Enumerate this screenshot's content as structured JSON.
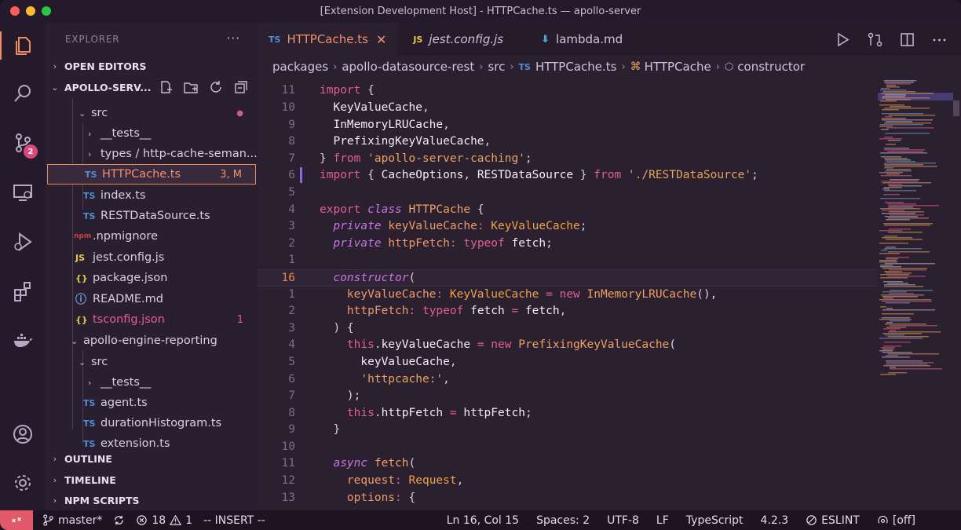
{
  "window": {
    "title": "[Extension Development Host] - HTTPCache.ts — apollo-server"
  },
  "activity": {
    "scm_badge": "2"
  },
  "sidebar": {
    "header": "EXPLORER",
    "more": "···",
    "sections": {
      "open_editors": "OPEN EDITORS",
      "project": "APOLLO-SERV...",
      "outline": "OUTLINE",
      "timeline": "TIMELINE",
      "npm_scripts": "NPM SCRIPTS"
    },
    "tree": [
      {
        "label": "src",
        "chev": "⌄",
        "icon": "",
        "deco": "●"
      },
      {
        "label": "__tests__",
        "chev": "›",
        "icon": "",
        "deco": ""
      },
      {
        "label": "types / http-cache-seman...",
        "chev": "›",
        "icon": "",
        "deco": ""
      },
      {
        "label": "HTTPCache.ts",
        "chev": "",
        "icon": "TS",
        "deco": "3, M"
      },
      {
        "label": "index.ts",
        "chev": "",
        "icon": "TS",
        "deco": ""
      },
      {
        "label": "RESTDataSource.ts",
        "chev": "",
        "icon": "TS",
        "deco": ""
      },
      {
        "label": ".npmignore",
        "chev": "",
        "icon": "npm",
        "deco": ""
      },
      {
        "label": "jest.config.js",
        "chev": "",
        "icon": "JS",
        "deco": ""
      },
      {
        "label": "package.json",
        "chev": "",
        "icon": "{}",
        "deco": ""
      },
      {
        "label": "README.md",
        "chev": "",
        "icon": "ⓘ",
        "deco": ""
      },
      {
        "label": "tsconfig.json",
        "chev": "",
        "icon": "{}",
        "deco": "1"
      },
      {
        "label": "apollo-engine-reporting",
        "chev": "⌄",
        "icon": "",
        "deco": ""
      },
      {
        "label": "src",
        "chev": "⌄",
        "icon": "",
        "deco": ""
      },
      {
        "label": "__tests__",
        "chev": "›",
        "icon": "",
        "deco": ""
      },
      {
        "label": "agent.ts",
        "chev": "",
        "icon": "TS",
        "deco": ""
      },
      {
        "label": "durationHistogram.ts",
        "chev": "",
        "icon": "TS",
        "deco": ""
      },
      {
        "label": "extension.ts",
        "chev": "",
        "icon": "TS",
        "deco": ""
      }
    ]
  },
  "tabs": [
    {
      "icon": "TS",
      "label": "HTTPCache.ts",
      "close": "✕"
    },
    {
      "icon": "JS",
      "label": "jest.config.js"
    },
    {
      "icon": "⬇",
      "label": "lambda.md"
    }
  ],
  "breadcrumb": [
    "packages",
    "apollo-datasource-rest",
    "src",
    "HTTPCache.ts",
    "HTTPCache",
    "constructor"
  ],
  "breadcrumb_icons": {
    "ts": "TS"
  },
  "editor": {
    "line_numbers": [
      "11",
      "10",
      "9",
      "8",
      "7",
      "6",
      "5",
      "4",
      "3",
      "2",
      "1",
      "16",
      "1",
      "2",
      "3",
      "4",
      "5",
      "6",
      "7",
      "8",
      "9",
      "10",
      "11",
      "12",
      "13"
    ],
    "current_line_index": 11
  },
  "status": {
    "branch": "master*",
    "errors": "18",
    "warnings": "1",
    "mode": "-- INSERT --",
    "position": "Ln 16, Col 15",
    "spaces": "Spaces: 2",
    "encoding": "UTF-8",
    "eol": "LF",
    "language": "TypeScript",
    "ts_version": "4.2.3",
    "eslint": "ESLINT",
    "off": "[off]"
  },
  "colors": {
    "accent": "#f08b5c",
    "badge": "#d8497a",
    "remote": "#e05a6a",
    "modified": "#e58b4e"
  }
}
